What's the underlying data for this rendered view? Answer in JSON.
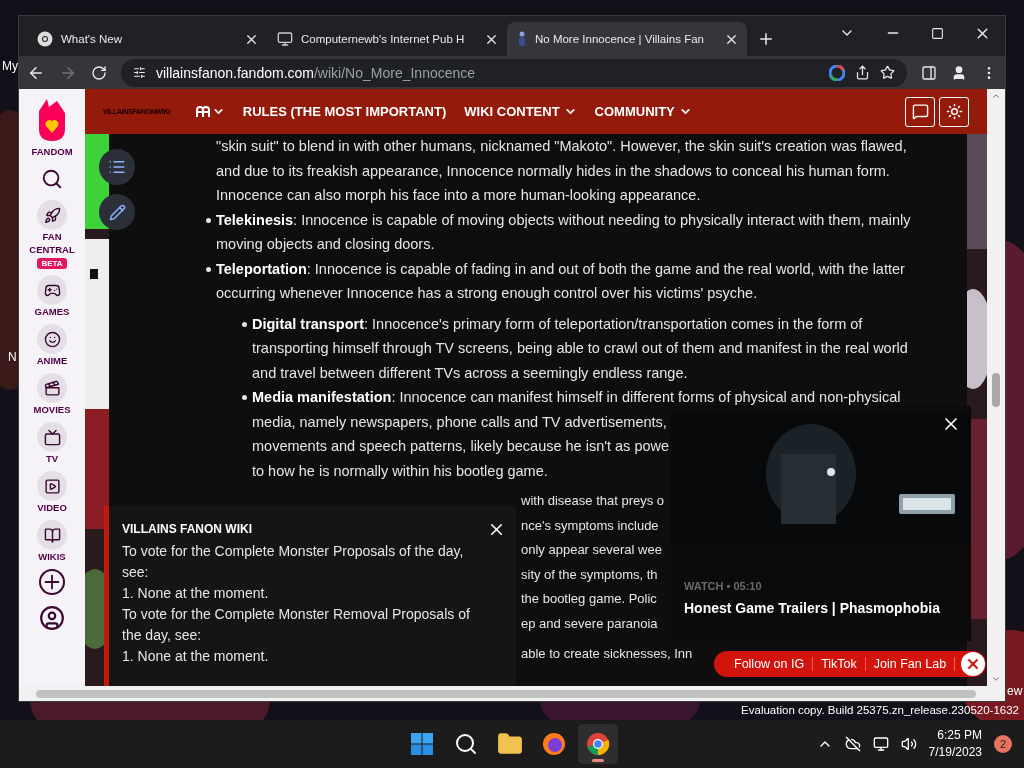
{
  "desktop": {
    "icon_labels": [
      "My",
      "N"
    ],
    "corner_label": "ew",
    "watermark": "Evaluation copy. Build 25375.zn_release.230520-1632"
  },
  "browser": {
    "tabs": [
      {
        "title": "What's New",
        "selected": false
      },
      {
        "title": "Computernewb's Internet Pub H",
        "selected": false
      },
      {
        "title": "No More Innocence | Villains Fan",
        "selected": true
      }
    ],
    "forward_disabled": true,
    "address": {
      "host": "villainsfanon.fandom.com",
      "path": "/wiki/No_More_Innocence"
    }
  },
  "fandom_sidebar": {
    "brand": "FANDOM",
    "items": [
      {
        "label": "FAN CENTRAL",
        "badge": "BETA"
      },
      {
        "label": "GAMES"
      },
      {
        "label": "ANIME"
      },
      {
        "label": "MOVIES"
      },
      {
        "label": "TV"
      },
      {
        "label": "VIDEO"
      },
      {
        "label": "WIKIS"
      }
    ]
  },
  "wiki_header": {
    "logo": "VILLAINSFANONWIKI",
    "nav": [
      {
        "label": "RULES (THE MOST IMPORTANT)",
        "dropdown": false
      },
      {
        "label": "WIKI CONTENT",
        "dropdown": true
      },
      {
        "label": "COMMUNITY",
        "dropdown": true
      }
    ]
  },
  "article": {
    "items": [
      {
        "kind": "continuation",
        "lines": [
          "\"skin suit\" to blend in with other humans, nicknamed \"Makoto\". However, the skin suit's creation was flawed,",
          "and due to its freakish appearance, Innocence normally hides in the shadows to conceal his human form.",
          "Innocence can also morph his face into a more human-looking appearance."
        ]
      },
      {
        "kind": "bullet",
        "lines": [
          "**Telekinesis**: Innocence is capable of moving objects without needing to physically interact with them, mainly",
          "moving objects and closing doors."
        ]
      },
      {
        "kind": "bullet",
        "lines": [
          "**Teleportation**: Innocence is capable of fading in and out of both the game and the real world, with the latter",
          "occurring whenever Innocence has a strong enough control over his victims' psyche."
        ],
        "children": [
          {
            "kind": "bullet",
            "lines": [
              "**Digital transport**: Innocence's primary form of teleportation/transportation comes in the form of",
              "transporting himself through TV screens, being able to crawl out of them and manifest in the real world",
              "and travel between different TVs across a seemingly endless range."
            ]
          },
          {
            "kind": "bullet",
            "lines": [
              "**Media manifestation**: Innocence can manifest himself in different forms of physical and non-physical",
              "media, namely newspapers, phone calls and TV advertisements,",
              "movements and speech patterns, likely because he isn't as powe",
              "to how he is normally within his bootleg game."
            ]
          }
        ]
      },
      {
        "kind": "fragment",
        "lines": [
          "with disease that preys o",
          "nce's symptoms include",
          "only appear several wee",
          "sity of the symptoms, th",
          "the bootleg game. Polic",
          "ep and severe paranoia"
        ]
      },
      {
        "kind": "fragment",
        "lines": [
          "able to create sicknesses, Inn"
        ]
      }
    ]
  },
  "notice_popup": {
    "title": "VILLAINS FANON WIKI",
    "lines": [
      "To vote for the Complete Monster Proposals of the day, see:",
      "1. None at the moment.",
      "To vote for the Complete Monster Removal Proposals of the day, see:",
      "1. None at the moment."
    ]
  },
  "video_popup": {
    "meta": "WATCH • 05:10",
    "title": "Honest Game Trailers | Phasmophobia"
  },
  "follow_bar": {
    "links": [
      "Follow on IG",
      "TikTok",
      "Join Fan Lab"
    ]
  },
  "taskbar": {
    "apps": [
      {
        "selected": false
      },
      {
        "selected": false
      },
      {
        "selected": false
      },
      {
        "selected": false
      },
      {
        "selected": true
      }
    ],
    "time": "6:25 PM",
    "date": "7/19/2023",
    "notifications": "2"
  }
}
